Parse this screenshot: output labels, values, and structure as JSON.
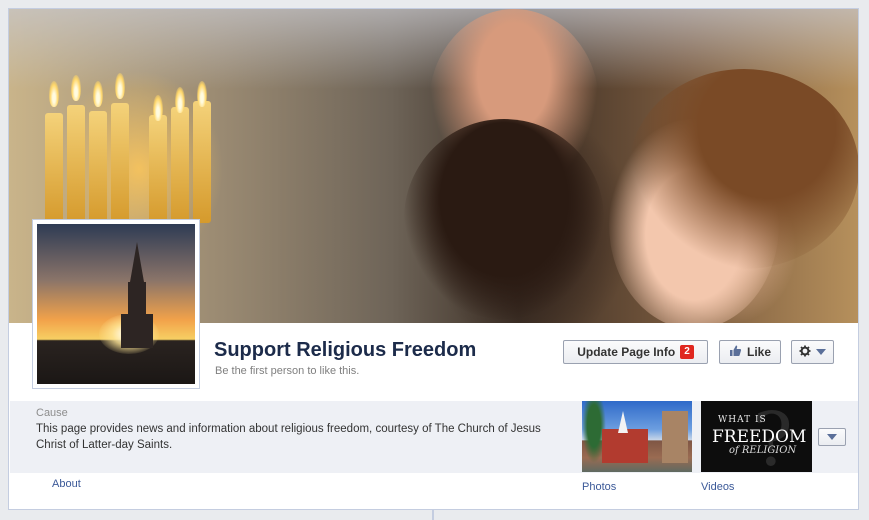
{
  "page": {
    "title": "Support Religious Freedom",
    "subtitle": "Be the first person to like this."
  },
  "actions": {
    "update_label": "Update Page Info",
    "update_badge": "2",
    "like_label": "Like",
    "gear_icon": "gear-icon"
  },
  "about_box": {
    "label": "Cause",
    "text": "This page provides news and information about religious freedom, courtesy of The Church of Jesus Christ of Latter-day Saints.",
    "link": "About"
  },
  "apps": [
    {
      "label": "Photos"
    },
    {
      "label": "Videos",
      "thumb_lines": [
        "WHAT IS",
        "FREEDOM",
        "of RELIGION"
      ],
      "thumb_glyph": "?"
    }
  ],
  "icons": {
    "like": "thumbs-up-icon",
    "more": "chevron-down-icon"
  },
  "colors": {
    "link": "#3b5998",
    "badge": "#e0271f",
    "title": "#1c2b4a"
  }
}
